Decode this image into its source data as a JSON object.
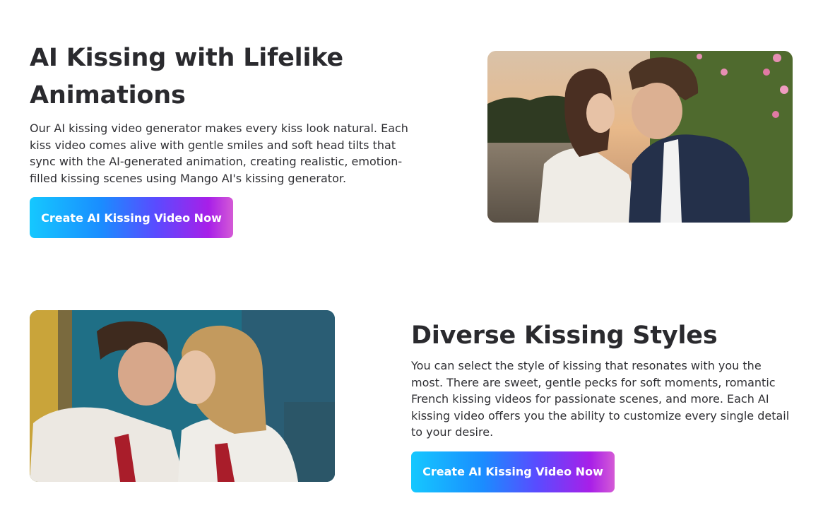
{
  "sections": [
    {
      "title": "AI Kissing with Lifelike Animations",
      "description": "Our AI kissing video generator makes every kiss look natural. Each kiss video comes alive with gentle smiles and soft head tilts that sync with the AI-generated animation, creating realistic, emotion-filled kissing scenes using Mango AI's kissing generator.",
      "cta_label": "Create AI Kissing Video Now"
    },
    {
      "title": "Diverse Kissing Styles",
      "description": "You can select the style of kissing that resonates with you the most. There are sweet, gentle pecks for soft moments, romantic French kissing videos for passionate scenes, and more. Each AI kissing video offers you the ability to customize every single detail to your desire.",
      "cta_label": "Create AI Kissing Video Now"
    }
  ],
  "colors": {
    "heading": "#2a2a2e",
    "body_text": "#2f2f33",
    "button_gradient_start": "#15c8ff",
    "button_gradient_mid": "#5a4bff",
    "button_gradient_end": "#d45ad6",
    "button_text": "#ffffff"
  }
}
